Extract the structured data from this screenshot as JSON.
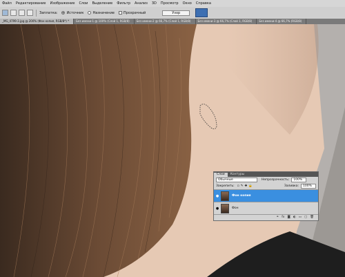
{
  "menu": [
    "Файл",
    "Редактирование",
    "Изображение",
    "Слои",
    "Выделение",
    "Фильтр",
    "Анализ",
    "3D",
    "Просмотр",
    "Окно",
    "Справка"
  ],
  "options": {
    "patch_label": "Заплатка:",
    "source_label": "Источник",
    "target_label": "Назначение",
    "transparent_label": "Прозрачный",
    "pattern_button": "Узор"
  },
  "tabs": [
    "_MG_4799-3.jpg @ 200% (Фон копия, RGB/8*) *",
    "Без имени-1 @ 100% (Слой 1, RGB/8)",
    "Без имени-2 @ 66,7% (Слой 1, RGB/8)",
    "Без имени-3 @ 66,7% (Слой 1, RGB/8)",
    "Без имени-4 @ 66,7% (RGB/8)"
  ],
  "layers_panel": {
    "tabs": [
      "Слои",
      "Контуры"
    ],
    "blend_mode": "Обычные",
    "opacity_label": "Непрозрачность:",
    "opacity_value": "100%",
    "lock_label": "Закрепить:",
    "fill_label": "Заливка:",
    "fill_value": "100%",
    "layers": [
      {
        "name": "Фон копия",
        "selected": true
      },
      {
        "name": "Фон",
        "selected": false
      }
    ]
  },
  "colors": {
    "selection_blue": "#3a8fe0",
    "ui_gray": "#d3d3d3"
  }
}
